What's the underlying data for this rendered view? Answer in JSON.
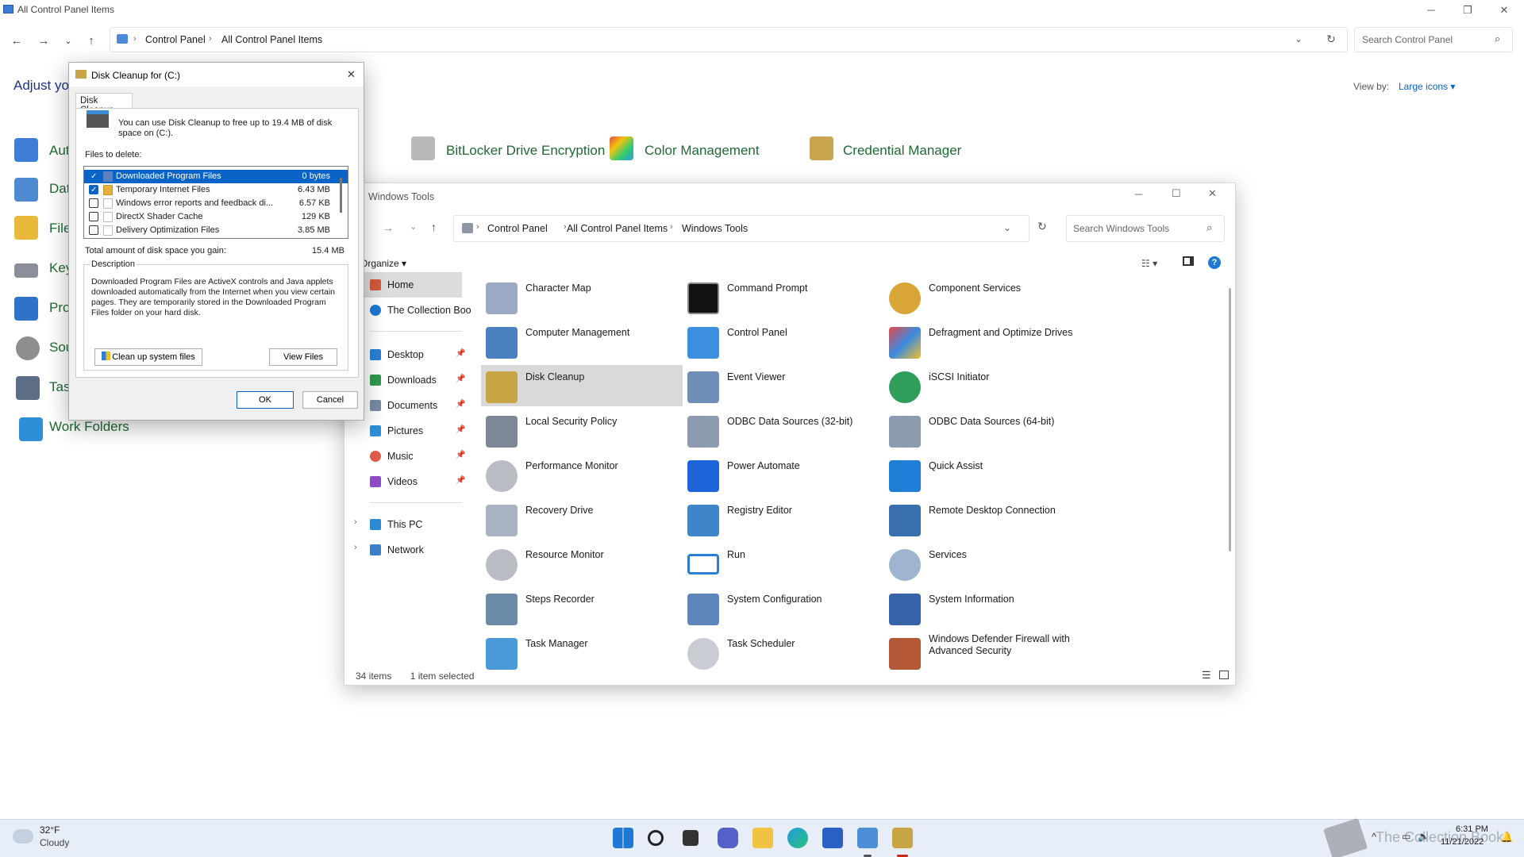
{
  "control_panel": {
    "title": "All Control Panel Items",
    "breadcrumb": [
      "Control Panel",
      "All Control Panel Items"
    ],
    "search_placeholder": "Search Control Panel",
    "heading": "Adjust you",
    "view_by_label": "View by:",
    "view_by_value": "Large icons",
    "items_visible": [
      "BitLocker Drive Encryption",
      "Color Management",
      "Credential Manager"
    ],
    "left_items": [
      "Aut",
      "Dat",
      "File",
      "Key",
      "Pro",
      "Sou",
      "Task",
      "Work Folders"
    ]
  },
  "windows_tools": {
    "title": "Windows Tools",
    "breadcrumb": [
      "Control Panel",
      "All Control Panel Items",
      "Windows Tools"
    ],
    "search_placeholder": "Search Windows Tools",
    "organize_label": "Organize",
    "nav": {
      "home": "Home",
      "onedrive": "The Collection Boo",
      "quick": [
        "Desktop",
        "Downloads",
        "Documents",
        "Pictures",
        "Music",
        "Videos"
      ],
      "this_pc": "This PC",
      "network": "Network"
    },
    "tools": [
      [
        "Character Map",
        "Command Prompt",
        "Component Services"
      ],
      [
        "Computer Management",
        "Control Panel",
        "Defragment and Optimize Drives"
      ],
      [
        "Disk Cleanup",
        "Event Viewer",
        "iSCSI Initiator"
      ],
      [
        "Local Security Policy",
        "ODBC Data Sources (32-bit)",
        "ODBC Data Sources (64-bit)"
      ],
      [
        "Performance Monitor",
        "Power Automate",
        "Quick Assist"
      ],
      [
        "Recovery Drive",
        "Registry Editor",
        "Remote Desktop Connection"
      ],
      [
        "Resource Monitor",
        "Run",
        "Services"
      ],
      [
        "Steps Recorder",
        "System Configuration",
        "System Information"
      ],
      [
        "Task Manager",
        "Task Scheduler",
        "Windows Defender Firewall with Advanced Security"
      ]
    ],
    "selected_tool": "Disk Cleanup",
    "status_count": "34 items",
    "status_selected": "1 item selected"
  },
  "disk_cleanup": {
    "title": "Disk Cleanup for  (C:)",
    "tab": "Disk Cleanup",
    "intro": "You can use Disk Cleanup to free up to 19.4 MB of disk space on  (C:).",
    "files_label": "Files to delete:",
    "files": [
      {
        "name": "Downloaded Program Files",
        "size": "0 bytes",
        "checked": true
      },
      {
        "name": "Temporary Internet Files",
        "size": "6.43 MB",
        "checked": true
      },
      {
        "name": "Windows error reports and feedback di...",
        "size": "6.57 KB",
        "checked": false
      },
      {
        "name": "DirectX Shader Cache",
        "size": "129 KB",
        "checked": false
      },
      {
        "name": "Delivery Optimization Files",
        "size": "3.85 MB",
        "checked": false
      }
    ],
    "total_label": "Total amount of disk space you gain:",
    "total_value": "15.4 MB",
    "description_label": "Description",
    "description": "Downloaded Program Files are ActiveX controls and Java applets downloaded automatically from the Internet when you view certain pages. They are temporarily stored in the Downloaded Program Files folder on your hard disk.",
    "cleanup_system_label": "Clean up system files",
    "view_files_label": "View Files",
    "ok_label": "OK",
    "cancel_label": "Cancel"
  },
  "taskbar": {
    "weather_temp": "32°F",
    "weather_desc": "Cloudy",
    "time": "6:31 PM",
    "date": "11/21/2022",
    "watermark": "The Collection Book"
  },
  "colors": {
    "accent": "#0a64c8",
    "cp_link": "#1e6a32",
    "cp_heading": "#1e3287",
    "selection": "#d9d9d9"
  }
}
